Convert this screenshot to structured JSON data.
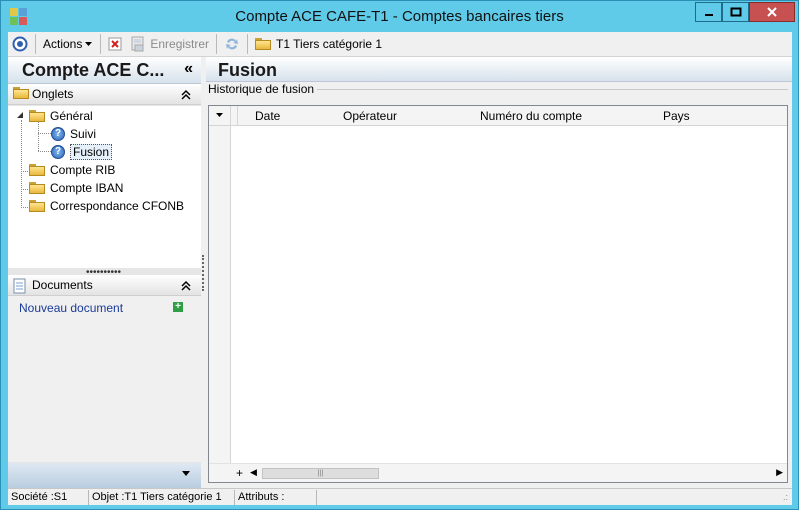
{
  "window": {
    "title": "Compte ACE CAFE-T1 -  Comptes bancaires tiers"
  },
  "toolbar": {
    "actions_label": "Actions",
    "save_label": "Enregistrer",
    "category_label": "T1 Tiers catégorie 1"
  },
  "left_panel": {
    "title": "Compte ACE C...",
    "collapse_glyph": "«",
    "tabs_section": {
      "label": "Onglets",
      "tree": [
        {
          "label": "Général",
          "type": "folder",
          "expanded": true,
          "children": [
            {
              "label": "Suivi",
              "type": "help"
            },
            {
              "label": "Fusion",
              "type": "help",
              "selected": true
            }
          ]
        },
        {
          "label": "Compte RIB",
          "type": "folder"
        },
        {
          "label": "Compte IBAN",
          "type": "folder"
        },
        {
          "label": "Correspondance CFONB",
          "type": "folder"
        }
      ]
    },
    "documents_section": {
      "label": "Documents",
      "new_document_link": "Nouveau document"
    }
  },
  "main": {
    "title": "Fusion",
    "group_label": "Historique de fusion",
    "grid": {
      "columns": [
        "Date",
        "Opérateur",
        "Numéro du compte",
        "Pays"
      ],
      "rows": []
    }
  },
  "statusbar": {
    "company": "Société :S1",
    "object": "Objet :T1 Tiers catégorie 1",
    "attributes": "Attributs :"
  },
  "colors": {
    "titlebar": "#5fcbe8",
    "close_button": "#c75050",
    "link": "#1a3a9a"
  }
}
